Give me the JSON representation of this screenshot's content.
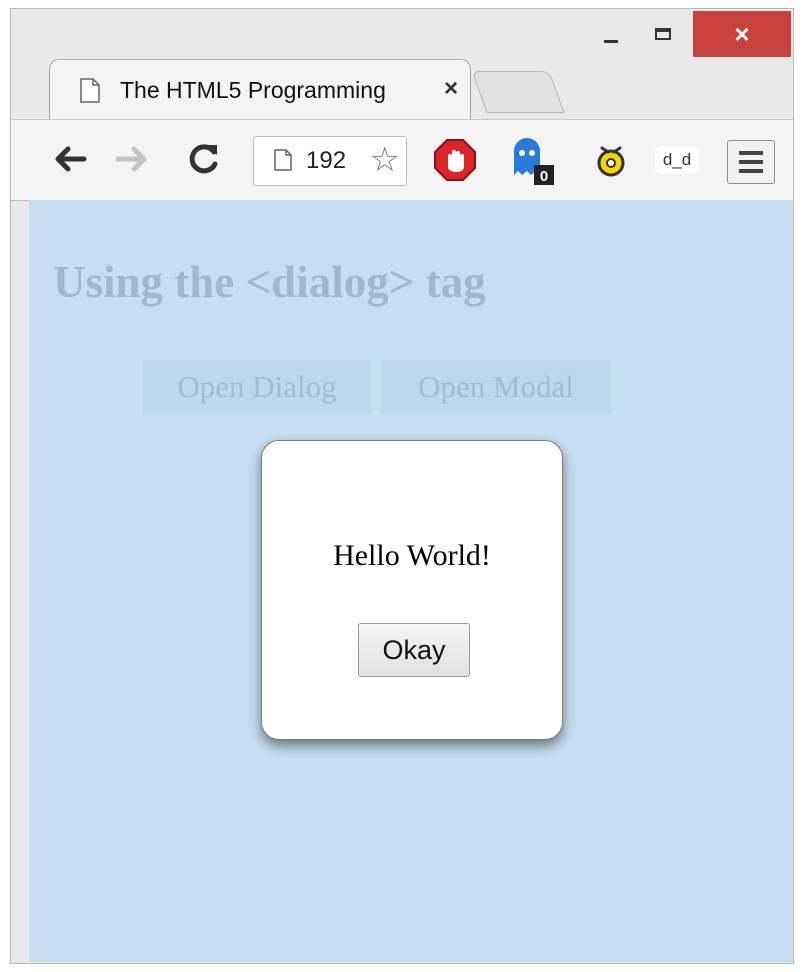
{
  "window": {
    "close_glyph": "×",
    "accent_close": "#c7413d"
  },
  "tab": {
    "title": "The HTML5 Programming",
    "close_glyph": "×"
  },
  "toolbar": {
    "back_icon": "back-arrow-icon",
    "forward_icon": "forward-arrow-icon",
    "reload_icon": "reload-icon",
    "address": "192",
    "star_glyph": "☆",
    "extensions": [
      "stop-sign-icon",
      "ghost-icon",
      "yellow-face-icon",
      "face-icon"
    ],
    "ext_dd_label": "d_d",
    "menu_icon": "hamburger-menu-icon"
  },
  "page": {
    "background": "#c5dff1",
    "title": "Using the <dialog> tag",
    "buttons": [
      "Open Dialog",
      "Open Modal"
    ]
  },
  "dialog": {
    "message": "Hello World!",
    "okay_label": "Okay"
  }
}
